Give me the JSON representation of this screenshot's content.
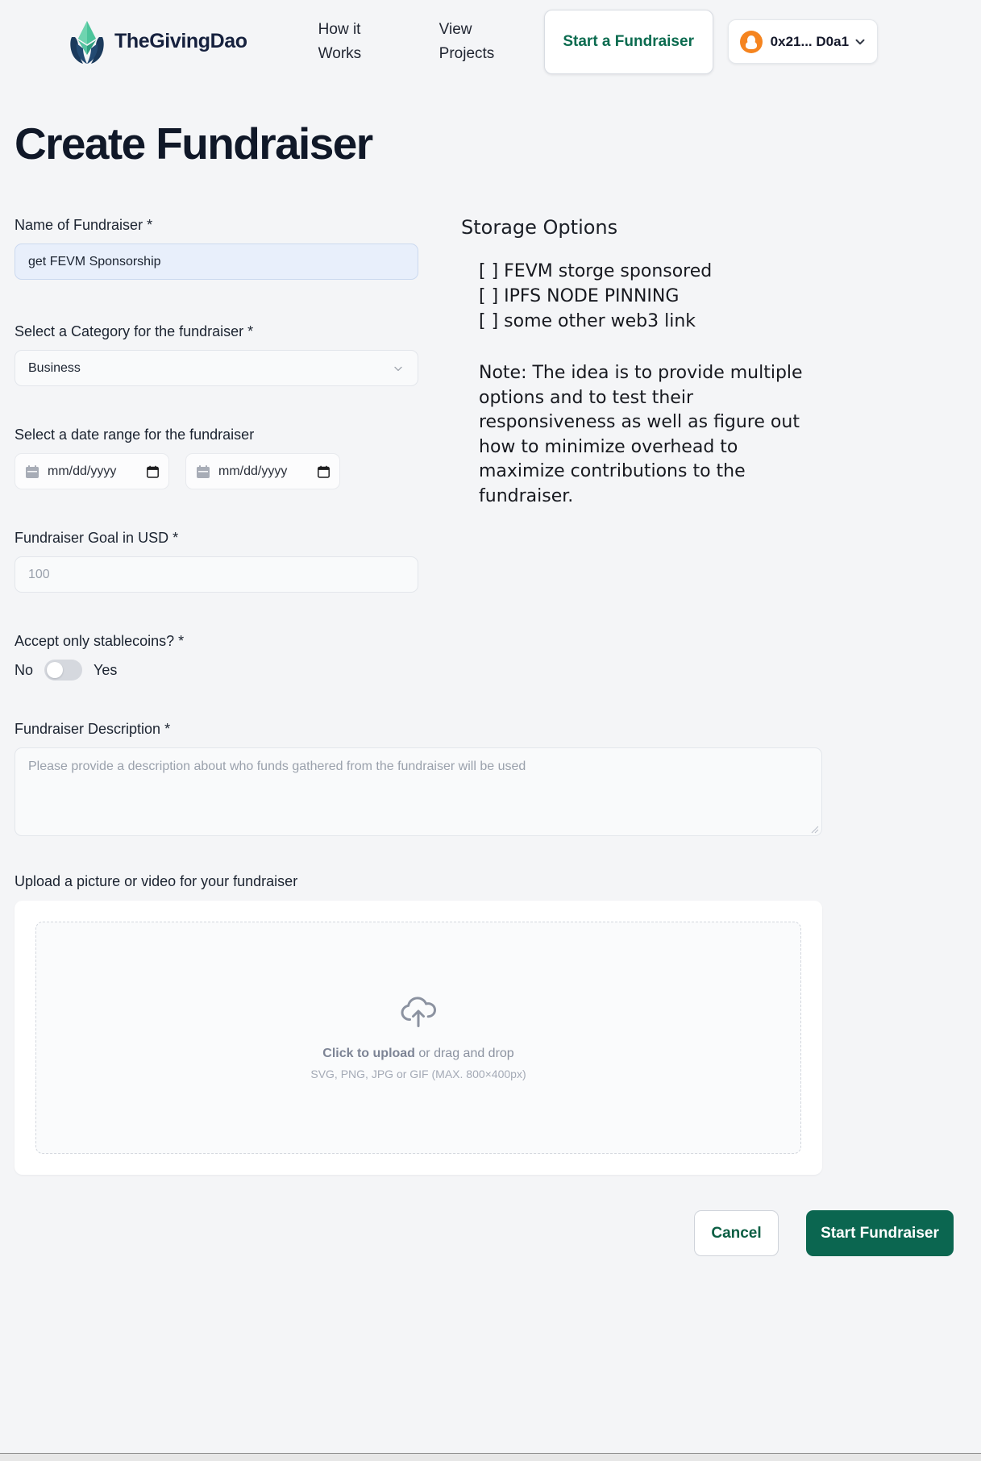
{
  "header": {
    "brand_name": "TheGivingDao",
    "nav": [
      {
        "label": "How it Works"
      },
      {
        "label": "View Projects"
      }
    ],
    "cta_label": "Start a Fundraiser",
    "wallet": {
      "address": "0x21... D0a1",
      "icon": "metamask-fox-icon",
      "chevron": "chevron-down-icon"
    }
  },
  "page_title": "Create Fundraiser",
  "form": {
    "name": {
      "label": "Name of Fundraiser *",
      "value": "get FEVM Sponsorship"
    },
    "category": {
      "label": "Select a Category for the fundraiser *",
      "value": "Business"
    },
    "date_range": {
      "label": "Select a date range for the fundraiser",
      "start_placeholder": "mm/dd/yyyy",
      "end_placeholder": "mm/dd/yyyy"
    },
    "goal": {
      "label": "Fundraiser Goal in USD *",
      "placeholder": "100"
    },
    "stablecoins": {
      "label": "Accept only stablecoins? *",
      "off_label": "No",
      "on_label": "Yes",
      "state": "off"
    },
    "description": {
      "label": "Fundraiser Description *",
      "placeholder": "Please provide a description about who funds gathered from the fundraiser will be used"
    },
    "upload": {
      "label": "Upload a picture or video for your fundraiser",
      "icon": "cloud-upload-icon",
      "primary_text": "Click to upload",
      "secondary_text": " or drag and drop",
      "hint": "SVG, PNG, JPG or GIF (MAX. 800×400px)"
    }
  },
  "storage": {
    "title": "Storage Options",
    "options": [
      "[ ] FEVM storge sponsored",
      "[ ] IPFS NODE PINNING",
      "[ ] some other web3 link"
    ],
    "note": "Note: The idea is to provide multiple options and to test their responsiveness as well as figure out how to minimize overhead to maximize contributions to the fundraiser."
  },
  "footer": {
    "cancel_label": "Cancel",
    "submit_label": "Start Fundraiser"
  },
  "colors": {
    "brand_green": "#0b6650",
    "cta_green": "#0b6b4f",
    "page_bg": "#f4f5f7",
    "autofill_blue": "#e8effb",
    "wallet_orange": "#f5841f"
  }
}
